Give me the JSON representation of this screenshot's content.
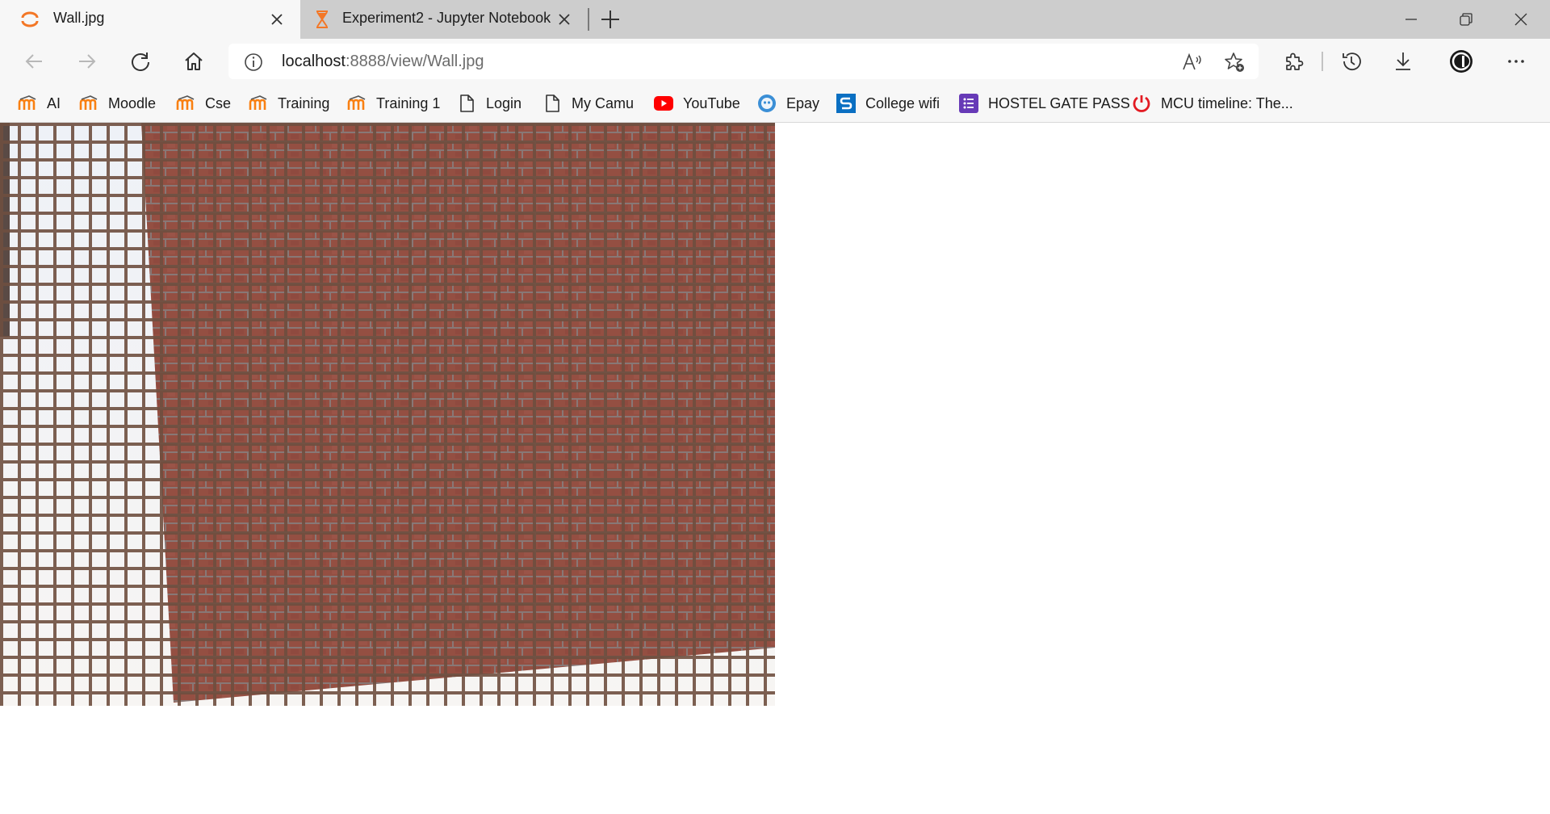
{
  "tabs": [
    {
      "title": "Wall.jpg",
      "icon": "jupyter-logo-icon",
      "active": true
    },
    {
      "title": "Experiment2 - Jupyter Notebook",
      "icon": "hourglass-icon",
      "active": false
    }
  ],
  "address_bar": {
    "host": "localhost",
    "rest": ":8888/view/Wall.jpg"
  },
  "bookmarks": [
    {
      "label": "AI",
      "icon": "moodle-icon"
    },
    {
      "label": "Moodle",
      "icon": "moodle-icon"
    },
    {
      "label": "Cse",
      "icon": "moodle-icon"
    },
    {
      "label": "Training",
      "icon": "moodle-icon"
    },
    {
      "label": "Training 1",
      "icon": "moodle-icon"
    },
    {
      "label": "Login",
      "icon": "page-icon"
    },
    {
      "label": "My Camu",
      "icon": "page-icon"
    },
    {
      "label": "YouTube",
      "icon": "youtube-icon"
    },
    {
      "label": "Epay",
      "icon": "epay-icon"
    },
    {
      "label": "College wifi",
      "icon": "s-logo-icon"
    },
    {
      "label": "HOSTEL GATE PASS",
      "icon": "forms-icon"
    },
    {
      "label": "MCU timeline: The...",
      "icon": "power-icon"
    }
  ],
  "colors": {
    "brick": "#9c4f42",
    "mesh": "#6b4a3a",
    "sky": "#f2f3f7",
    "accent": "#f37726"
  },
  "image": {
    "name": "Wall.jpg",
    "description_icon": "brick-wall-through-mesh-image"
  }
}
